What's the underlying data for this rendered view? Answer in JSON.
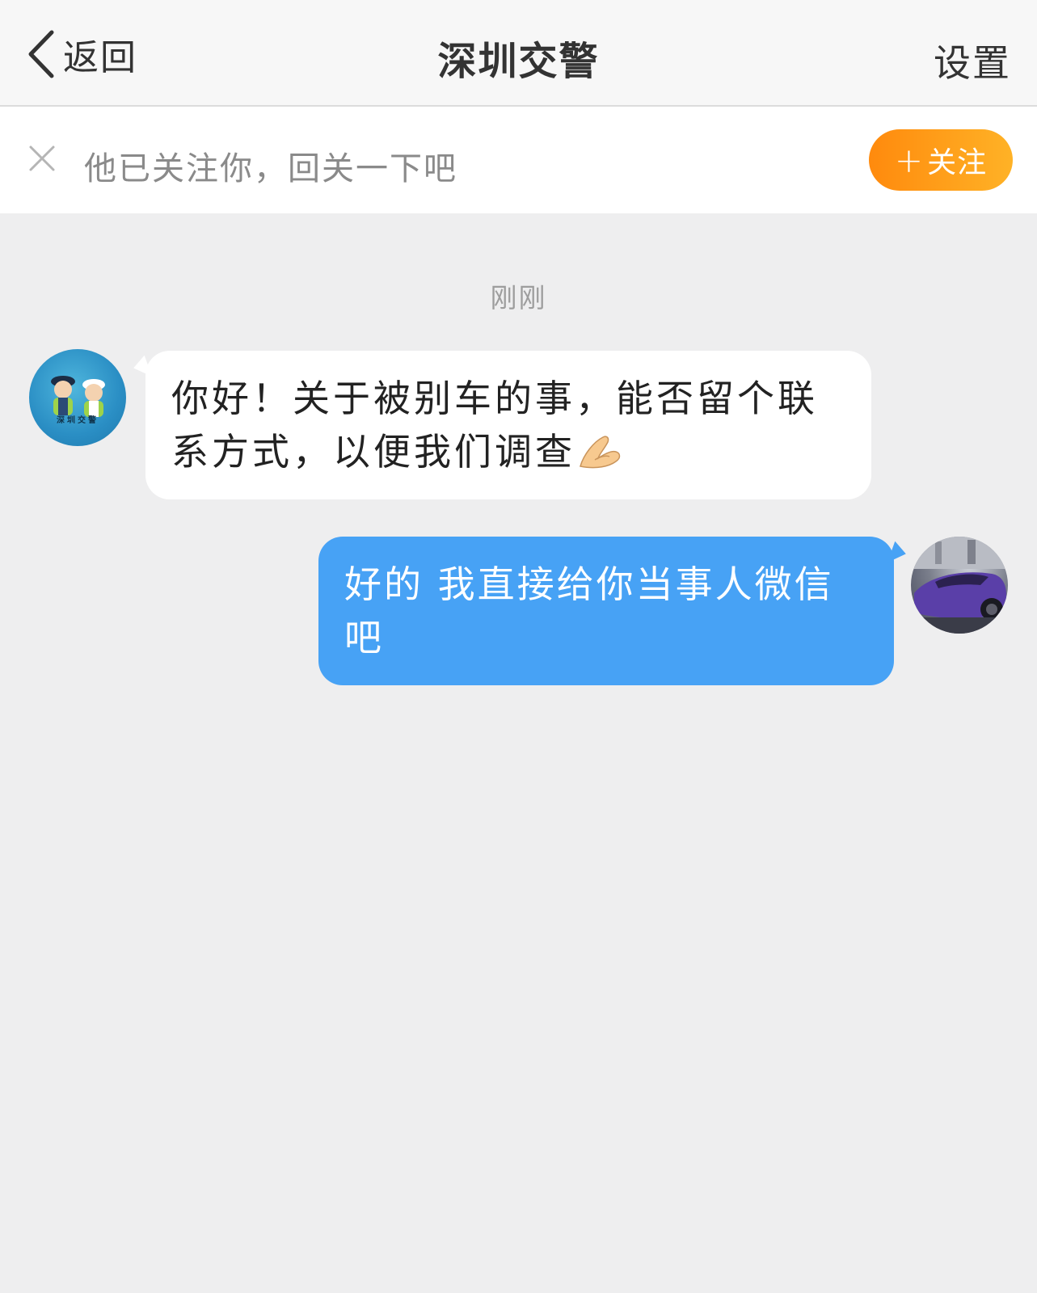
{
  "navbar": {
    "back_label": "返回",
    "title": "深圳交警",
    "settings_label": "设置"
  },
  "follow_bar": {
    "text": "他已关注你，回关一下吧",
    "button_plus": "+",
    "button_label": "关注",
    "button_color": "#ff9a1a"
  },
  "chat": {
    "timestamp": "刚刚",
    "messages": [
      {
        "direction": "incoming",
        "avatar_label": "深圳交警",
        "text": "你好！关于被别车的事，能否留个联系方式，以便我们调查",
        "emoji": "pinching-hand-emoji",
        "bubble_color": "#ffffff"
      },
      {
        "direction": "outgoing",
        "text": "好的 我直接给你当事人微信吧",
        "bubble_color": "#47a2f5"
      }
    ]
  },
  "colors": {
    "background": "#eeeeef",
    "accent_orange": "#ff9a1a",
    "accent_blue": "#47a2f5"
  }
}
